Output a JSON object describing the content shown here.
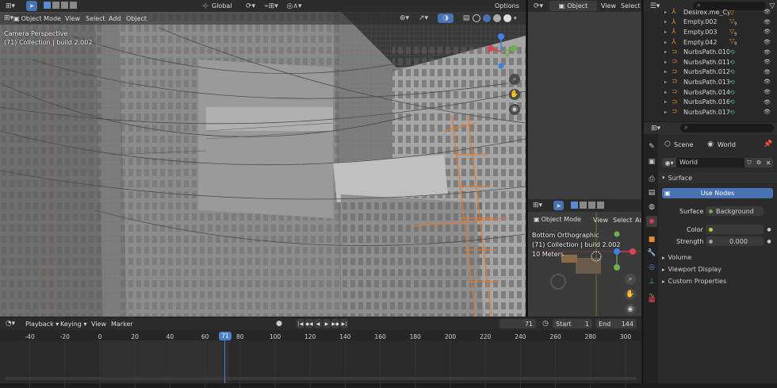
{
  "main_viewport": {
    "mode_label": "Object Mode",
    "menus": [
      "View",
      "Select",
      "Add",
      "Object"
    ],
    "transform_orientation": "Global",
    "options_label": "Options",
    "overlay_line1": "Camera Perspective",
    "overlay_line2": "(71) Collection | build 2.002"
  },
  "right_top_viewport": {
    "mode_label": "Object",
    "menus": [
      "View",
      "Select"
    ]
  },
  "small_viewport": {
    "mode_label": "Object Mode",
    "menus": [
      "View",
      "Select",
      "Ad"
    ],
    "overlay_line1": "Bottom Orthographic",
    "overlay_line2": "(71) Collection | build 2.002",
    "overlay_line3": "10 Meters"
  },
  "outliner": {
    "items": [
      {
        "name": "Desirex.me_CyberProp_L",
        "type": "empty"
      },
      {
        "name": "Empty.002",
        "type": "empty",
        "badge": "9"
      },
      {
        "name": "Empty.003",
        "type": "empty",
        "badge": "9"
      },
      {
        "name": "Empty.042",
        "type": "empty",
        "badge": "9"
      },
      {
        "name": "NurbsPath.010",
        "type": "curve"
      },
      {
        "name": "NurbsPath.011",
        "type": "curve"
      },
      {
        "name": "NurbsPath.012",
        "type": "curve"
      },
      {
        "name": "NurbsPath.013",
        "type": "curve"
      },
      {
        "name": "NurbsPath.014",
        "type": "curve"
      },
      {
        "name": "NurbsPath.016",
        "type": "curve"
      },
      {
        "name": "NurbsPath.017",
        "type": "curve"
      }
    ]
  },
  "properties": {
    "breadcrumb_scene": "Scene",
    "breadcrumb_world": "World",
    "world_name": "World",
    "surface_header": "Surface",
    "use_nodes_label": "Use Nodes",
    "surface_label": "Surface",
    "surface_value": "Background",
    "color_label": "Color",
    "strength_label": "Strength",
    "strength_value": "0.000",
    "panels": [
      "Volume",
      "Viewport Display",
      "Custom Properties"
    ]
  },
  "timeline": {
    "menus": [
      "Playback",
      "Keying",
      "View",
      "Marker"
    ],
    "current_frame": "71",
    "start_label": "Start",
    "start_value": "1",
    "end_label": "End",
    "end_value": "144",
    "ticks": [
      "-40",
      "-20",
      "0",
      "20",
      "40",
      "60",
      "71",
      "80",
      "100",
      "120",
      "140",
      "160",
      "180",
      "200",
      "220",
      "240",
      "260",
      "280",
      "300"
    ],
    "tick_values": [
      -40,
      -20,
      0,
      20,
      40,
      60,
      71,
      80,
      100,
      120,
      140,
      160,
      180,
      200,
      220,
      240,
      260,
      280,
      300
    ]
  },
  "colors": {
    "accent_blue": "#4772b3",
    "playhead": "#4a7fd0",
    "curve_orange": "#e47a30",
    "axis_red": "#e04050",
    "axis_green": "#6ab04c",
    "axis_blue": "#3f7fe6"
  }
}
